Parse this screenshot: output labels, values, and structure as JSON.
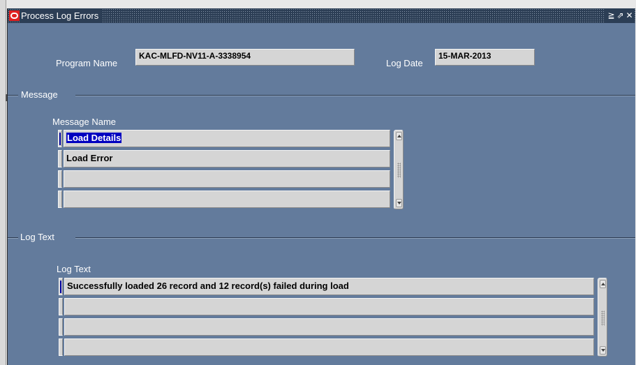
{
  "window": {
    "title": "Process Log Errors"
  },
  "header": {
    "program_name_label": "Program Name",
    "program_name_value": "KAC-MLFD-NV11-A-3338954",
    "log_date_label": "Log Date",
    "log_date_value": "15-MAR-2013"
  },
  "message_section": {
    "title": "Message",
    "column_label": "Message Name",
    "rows": [
      "Load Details",
      "Load Error",
      "",
      ""
    ]
  },
  "log_section": {
    "title": "Log Text",
    "column_label": "Log Text",
    "rows": [
      "Successfully loaded 26 record and 12 record(s) failed during load",
      "",
      "",
      ""
    ]
  },
  "icons": {
    "app": "oracle-o-icon",
    "controls": [
      "minimize-icon",
      "maximize-icon",
      "close-icon"
    ]
  },
  "colors": {
    "background": "#637b9c",
    "titlebar": "#2c3e55",
    "selection": "#0000c0",
    "oracle": "#e02020"
  }
}
